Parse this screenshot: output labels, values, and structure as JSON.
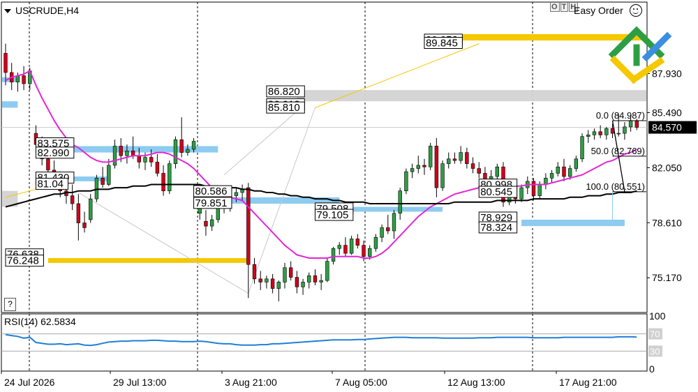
{
  "header": {
    "symbol": "USCRUDE,H4",
    "easy_order": "Easy Order",
    "one_click": [
      "O",
      "T",
      "H"
    ],
    "help": "?"
  },
  "colors": {
    "bull": "#2e9e45",
    "bear": "#d0021b",
    "ma_fast": "#e225d6",
    "ma_slow": "#000000",
    "support": "#8ecbf0",
    "target": "#f5c800",
    "grey_zone": "#d3d3d3",
    "rsi": "#1f7fd6",
    "last_price_bg": "#000000"
  },
  "chart_data": {
    "type": "candlestick",
    "symbol": "USCRUDE",
    "timeframe": "H4",
    "ylim": [
      73.0,
      92.4
    ],
    "y_ticks": [
      87.93,
      85.49,
      82.05,
      78.61,
      75.17
    ],
    "y_tick_labels": [
      "87.930",
      "85.490",
      "82.050",
      "78.610",
      "75.170"
    ],
    "x_labels": [
      "24 Jul 2026",
      "29 Jul 13:00",
      "3 Aug 21:00",
      "7 Aug 05:00",
      "12 Aug 13:00",
      "17 Aug 21:00"
    ],
    "last_price": 84.57,
    "last_price_label": "84.570",
    "candles": [
      [
        89.2,
        89.8,
        87.2,
        88.0
      ],
      [
        88.0,
        88.6,
        86.9,
        87.4
      ],
      [
        87.4,
        88.0,
        86.8,
        87.8
      ],
      [
        87.8,
        88.4,
        86.9,
        87.3
      ],
      [
        87.3,
        88.3,
        86.9,
        88.1
      ],
      [
        84.2,
        84.7,
        83.0,
        83.5
      ],
      [
        83.5,
        84.0,
        82.2,
        82.6
      ],
      [
        82.6,
        83.2,
        81.6,
        81.9
      ],
      [
        81.9,
        82.5,
        80.7,
        81.1
      ],
      [
        81.1,
        81.8,
        80.2,
        80.6
      ],
      [
        80.6,
        81.2,
        79.8,
        80.3
      ],
      [
        80.3,
        81.0,
        79.4,
        79.8
      ],
      [
        79.8,
        80.4,
        77.5,
        78.6
      ],
      [
        78.6,
        79.3,
        78.0,
        78.3
      ],
      [
        78.8,
        80.4,
        78.6,
        80.1
      ],
      [
        80.1,
        81.6,
        79.9,
        81.4
      ],
      [
        81.4,
        82.1,
        80.8,
        81.0
      ],
      [
        81.0,
        82.6,
        80.9,
        82.2
      ],
      [
        82.2,
        83.8,
        82.0,
        83.4
      ],
      [
        83.4,
        83.9,
        82.4,
        82.8
      ],
      [
        82.8,
        83.5,
        82.3,
        83.1
      ],
      [
        83.1,
        84.0,
        82.6,
        82.8
      ],
      [
        82.8,
        83.3,
        82.0,
        82.4
      ],
      [
        82.4,
        83.0,
        81.9,
        82.7
      ],
      [
        82.7,
        83.2,
        82.1,
        82.4
      ],
      [
        82.4,
        82.9,
        81.5,
        81.7
      ],
      [
        81.7,
        82.2,
        80.3,
        80.6
      ],
      [
        80.6,
        82.5,
        80.4,
        82.3
      ],
      [
        82.3,
        84.0,
        82.0,
        83.8
      ],
      [
        83.8,
        85.2,
        82.7,
        83.0
      ],
      [
        83.0,
        83.5,
        82.8,
        83.2
      ],
      [
        83.2,
        83.9,
        83.0,
        83.7
      ],
      [
        79.2,
        80.1,
        78.8,
        79.5
      ],
      [
        78.7,
        79.4,
        77.8,
        78.4
      ],
      [
        78.4,
        79.1,
        78.1,
        78.8
      ],
      [
        78.8,
        79.8,
        78.6,
        79.6
      ],
      [
        79.6,
        80.2,
        79.2,
        79.8
      ],
      [
        79.8,
        80.4,
        79.3,
        80.1
      ],
      [
        80.3,
        80.8,
        79.9,
        80.5
      ],
      [
        80.5,
        81.0,
        80.0,
        80.7
      ],
      [
        80.8,
        81.1,
        73.9,
        76.0
      ],
      [
        76.0,
        76.4,
        74.8,
        75.1
      ],
      [
        75.1,
        75.6,
        74.4,
        74.9
      ],
      [
        74.9,
        75.3,
        74.5,
        75.1
      ],
      [
        75.1,
        75.4,
        74.2,
        74.5
      ],
      [
        74.5,
        75.0,
        73.7,
        74.9
      ],
      [
        74.9,
        76.1,
        74.5,
        75.8
      ],
      [
        75.8,
        76.2,
        75.0,
        75.2
      ],
      [
        75.2,
        75.6,
        74.2,
        74.6
      ],
      [
        74.6,
        75.1,
        74.1,
        74.9
      ],
      [
        74.9,
        75.5,
        74.5,
        75.3
      ],
      [
        75.3,
        75.7,
        74.7,
        74.9
      ],
      [
        74.9,
        75.4,
        74.4,
        75.0
      ],
      [
        75.0,
        76.4,
        74.9,
        76.2
      ],
      [
        76.2,
        77.1,
        76.0,
        77.0
      ],
      [
        77.0,
        77.4,
        76.6,
        77.2
      ],
      [
        77.2,
        77.7,
        76.5,
        76.7
      ],
      [
        76.7,
        77.8,
        76.6,
        77.6
      ],
      [
        77.6,
        77.9,
        77.0,
        77.2
      ],
      [
        77.2,
        77.5,
        76.2,
        76.5
      ],
      [
        76.5,
        77.2,
        76.3,
        77.0
      ],
      [
        77.0,
        77.9,
        76.8,
        77.7
      ],
      [
        77.7,
        78.5,
        77.4,
        78.3
      ],
      [
        78.3,
        79.1,
        77.9,
        78.1
      ],
      [
        78.1,
        79.4,
        77.6,
        79.2
      ],
      [
        79.2,
        80.8,
        78.8,
        80.6
      ],
      [
        80.6,
        82.0,
        80.4,
        81.8
      ],
      [
        81.8,
        82.3,
        81.4,
        82.0
      ],
      [
        82.0,
        82.8,
        81.7,
        82.2
      ],
      [
        82.2,
        82.6,
        81.6,
        82.1
      ],
      [
        82.1,
        83.6,
        81.9,
        83.4
      ],
      [
        83.4,
        83.9,
        80.2,
        80.8
      ],
      [
        80.8,
        82.5,
        80.6,
        82.3
      ],
      [
        82.3,
        83.0,
        82.0,
        82.6
      ],
      [
        82.6,
        83.0,
        82.3,
        82.5
      ],
      [
        82.5,
        83.4,
        82.3,
        83.0
      ],
      [
        83.0,
        83.3,
        82.0,
        82.3
      ],
      [
        82.3,
        82.7,
        81.7,
        82.0
      ],
      [
        82.0,
        82.4,
        81.4,
        81.7
      ],
      [
        81.7,
        82.1,
        80.9,
        81.2
      ],
      [
        81.2,
        81.9,
        80.7,
        81.5
      ],
      [
        81.5,
        82.3,
        81.2,
        82.1
      ],
      [
        82.1,
        82.4,
        79.6,
        79.9
      ],
      [
        79.9,
        80.8,
        79.7,
        80.6
      ],
      [
        80.6,
        81.0,
        79.8,
        80.1
      ],
      [
        80.1,
        81.0,
        79.9,
        80.8
      ],
      [
        80.8,
        81.5,
        80.4,
        81.2
      ],
      [
        81.2,
        81.4,
        80.0,
        80.3
      ],
      [
        80.3,
        81.2,
        80.1,
        81.0
      ],
      [
        81.0,
        81.7,
        80.7,
        81.4
      ],
      [
        81.4,
        81.9,
        81.1,
        81.7
      ],
      [
        81.7,
        82.4,
        81.5,
        82.1
      ],
      [
        82.1,
        82.6,
        81.2,
        81.5
      ],
      [
        81.5,
        82.2,
        81.3,
        82.0
      ],
      [
        82.0,
        82.8,
        81.8,
        82.6
      ],
      [
        82.6,
        84.2,
        82.4,
        84.0
      ],
      [
        84.0,
        84.4,
        83.6,
        84.1
      ],
      [
        84.1,
        84.5,
        83.8,
        84.3
      ],
      [
        84.3,
        84.7,
        83.9,
        84.1
      ],
      [
        84.1,
        84.6,
        83.8,
        84.5
      ],
      [
        84.5,
        84.8,
        83.9,
        84.2
      ],
      [
        84.2,
        85.4,
        84.0,
        84.2
      ],
      [
        84.2,
        84.9,
        83.8,
        84.6
      ],
      [
        84.6,
        85.3,
        84.3,
        85.0
      ],
      [
        85.0,
        85.1,
        84.4,
        84.57
      ]
    ],
    "ma_fast": [
      87.5,
      87.7,
      87.8,
      87.9,
      88.1,
      87.2,
      86.4,
      85.7,
      85.0,
      84.4,
      83.9,
      83.5,
      83.3,
      83.0,
      82.7,
      82.5,
      82.4,
      82.4,
      82.5,
      82.6,
      82.7,
      82.8,
      82.8,
      82.8,
      82.9,
      83.0,
      83.0,
      82.9,
      82.7,
      82.5,
      82.3,
      82.0,
      81.6,
      81.2,
      80.8,
      80.5,
      80.3,
      80.2,
      80.1,
      80.0,
      79.6,
      79.2,
      78.8,
      78.4,
      78.0,
      77.6,
      77.2,
      76.9,
      76.6,
      76.5,
      76.4,
      76.4,
      76.4,
      76.4,
      76.5,
      76.5,
      76.5,
      76.5,
      76.5,
      76.4,
      76.4,
      76.5,
      76.7,
      77.0,
      77.4,
      77.8,
      78.2,
      78.6,
      79.0,
      79.3,
      79.6,
      79.8,
      80.0,
      80.2,
      80.4,
      80.5,
      80.6,
      80.7,
      80.8,
      80.8,
      80.8,
      80.9,
      80.9,
      80.9,
      80.9,
      80.9,
      81.0,
      81.0,
      81.0,
      81.0,
      81.1,
      81.2,
      81.3,
      81.4,
      81.5,
      81.6,
      81.8,
      82.0,
      82.2,
      82.4,
      82.5,
      82.7,
      82.9,
      83.0,
      83.2
    ],
    "ma_slow": [
      79.6,
      79.7,
      79.8,
      79.9,
      80.0,
      80.1,
      80.2,
      80.3,
      80.4,
      80.4,
      80.5,
      80.5,
      80.6,
      80.6,
      80.6,
      80.7,
      80.7,
      80.7,
      80.8,
      80.8,
      80.8,
      80.9,
      80.9,
      80.9,
      81.0,
      81.0,
      81.0,
      81.0,
      81.0,
      81.0,
      81.0,
      81.0,
      81.0,
      80.9,
      80.9,
      80.9,
      80.8,
      80.8,
      80.8,
      80.7,
      80.7,
      80.6,
      80.6,
      80.5,
      80.5,
      80.4,
      80.4,
      80.3,
      80.3,
      80.2,
      80.2,
      80.1,
      80.1,
      80.1,
      80.0,
      80.0,
      79.9,
      79.9,
      79.9,
      79.9,
      79.8,
      79.8,
      79.8,
      79.8,
      79.8,
      79.8,
      79.8,
      79.8,
      79.8,
      79.8,
      79.8,
      79.8,
      79.8,
      79.8,
      79.9,
      79.9,
      79.9,
      79.9,
      79.9,
      79.9,
      79.9,
      80.0,
      80.0,
      80.0,
      80.0,
      80.0,
      80.0,
      80.1,
      80.1,
      80.1,
      80.1,
      80.1,
      80.1,
      80.2,
      80.2,
      80.2,
      80.3,
      80.3,
      80.3,
      80.4,
      80.4,
      80.5,
      80.5,
      80.5,
      80.6
    ],
    "zones": [
      {
        "kind": "support",
        "from_bar": 0,
        "to_bar": 2,
        "y1": 87.4,
        "y2": 87.7
      },
      {
        "kind": "support",
        "from_bar": 0,
        "to_bar": 2,
        "y1": 85.8,
        "y2": 86.2
      },
      {
        "kind": "grey",
        "from_bar": 0,
        "to_bar": 2,
        "y1": 79.6,
        "y2": 80.6
      },
      {
        "kind": "support",
        "from_bar": 6,
        "to_bar": 35,
        "y1": 83.0,
        "y2": 83.4
      },
      {
        "kind": "support",
        "from_bar": 6,
        "to_bar": 17,
        "y1": 81.2,
        "y2": 81.5
      },
      {
        "kind": "support",
        "from_bar": 35,
        "to_bar": 55,
        "y1": 79.8,
        "y2": 80.2
      },
      {
        "kind": "support",
        "from_bar": 53,
        "to_bar": 72,
        "y1": 79.3,
        "y2": 79.6
      },
      {
        "kind": "support",
        "from_bar": 85,
        "to_bar": 102,
        "y1": 78.4,
        "y2": 78.8
      },
      {
        "kind": "target",
        "from_bar": 7,
        "to_bar": 40,
        "y1": 76.1,
        "y2": 76.4
      },
      {
        "kind": "target",
        "from_bar": 75,
        "to_bar": 103,
        "y1": 90.0,
        "y2": 90.4
      },
      {
        "kind": "grey",
        "from_bar": 48,
        "to_bar": 103,
        "y1": 86.2,
        "y2": 86.9
      }
    ],
    "price_labels": [
      {
        "text": "90.052",
        "bar": 69,
        "y": 90.05
      },
      {
        "text": "89.845",
        "bar": 69,
        "y": 89.85
      },
      {
        "text": "86.820",
        "bar": 43,
        "y": 86.82
      },
      {
        "text": "86.013",
        "bar": 43,
        "y": 86.01
      },
      {
        "text": "85.810",
        "bar": 43,
        "y": 85.81
      },
      {
        "text": "83.575",
        "bar": 5,
        "y": 83.57
      },
      {
        "text": "82.990",
        "bar": 5,
        "y": 82.99
      },
      {
        "text": "81.430",
        "bar": 5,
        "y": 81.43
      },
      {
        "text": "81.04",
        "bar": 5,
        "y": 81.04
      },
      {
        "text": "80.586",
        "bar": 31,
        "y": 80.58
      },
      {
        "text": "79.851",
        "bar": 31,
        "y": 79.85
      },
      {
        "text": "79.508",
        "bar": 51,
        "y": 79.5
      },
      {
        "text": "79.105",
        "bar": 51,
        "y": 79.1
      },
      {
        "text": "76.638",
        "bar": 0,
        "y": 76.63
      },
      {
        "text": "76.248",
        "bar": 0,
        "y": 76.24
      },
      {
        "text": "80.998",
        "bar": 78,
        "y": 80.99
      },
      {
        "text": "80.545",
        "bar": 78,
        "y": 80.54
      },
      {
        "text": "78.929",
        "bar": 78,
        "y": 78.93
      },
      {
        "text": "78.324",
        "bar": 78,
        "y": 78.32
      }
    ],
    "fibo": [
      {
        "text": "0.0 (84.987)",
        "y": 84.99
      },
      {
        "text": "50.0 (82.769)",
        "y": 82.77
      },
      {
        "text": "100.0 (80.551)",
        "y": 80.55
      }
    ],
    "rsi": {
      "label": "RSI(14) 62.5834",
      "period": 14,
      "value": 62.5834,
      "levels": [
        70,
        30
      ],
      "level_labels": [
        "70",
        "30"
      ],
      "range_labels": [
        "100",
        "0"
      ],
      "ylim": [
        0,
        100
      ],
      "values": [
        68,
        66,
        64,
        60,
        62,
        50,
        48,
        46,
        46,
        47,
        45,
        46,
        47,
        44,
        43,
        45,
        48,
        51,
        52,
        53,
        53,
        54,
        54,
        54,
        55,
        55,
        54,
        53,
        53,
        52,
        52,
        52,
        53,
        52,
        50,
        48,
        47,
        47,
        45,
        44,
        44,
        44,
        45,
        45,
        47,
        47,
        48,
        49,
        50,
        51,
        52,
        53,
        54,
        55,
        56,
        56,
        56,
        56,
        57,
        57,
        58,
        59,
        60,
        61,
        62,
        62,
        62,
        61,
        61,
        61,
        61,
        61,
        60,
        60,
        60,
        60,
        60,
        60,
        61,
        61,
        61,
        62,
        62,
        62,
        62,
        62,
        62,
        61,
        61,
        61,
        61,
        61,
        62,
        62,
        62,
        62,
        62,
        62,
        62,
        62,
        62,
        63,
        63,
        63,
        62.58
      ]
    }
  }
}
